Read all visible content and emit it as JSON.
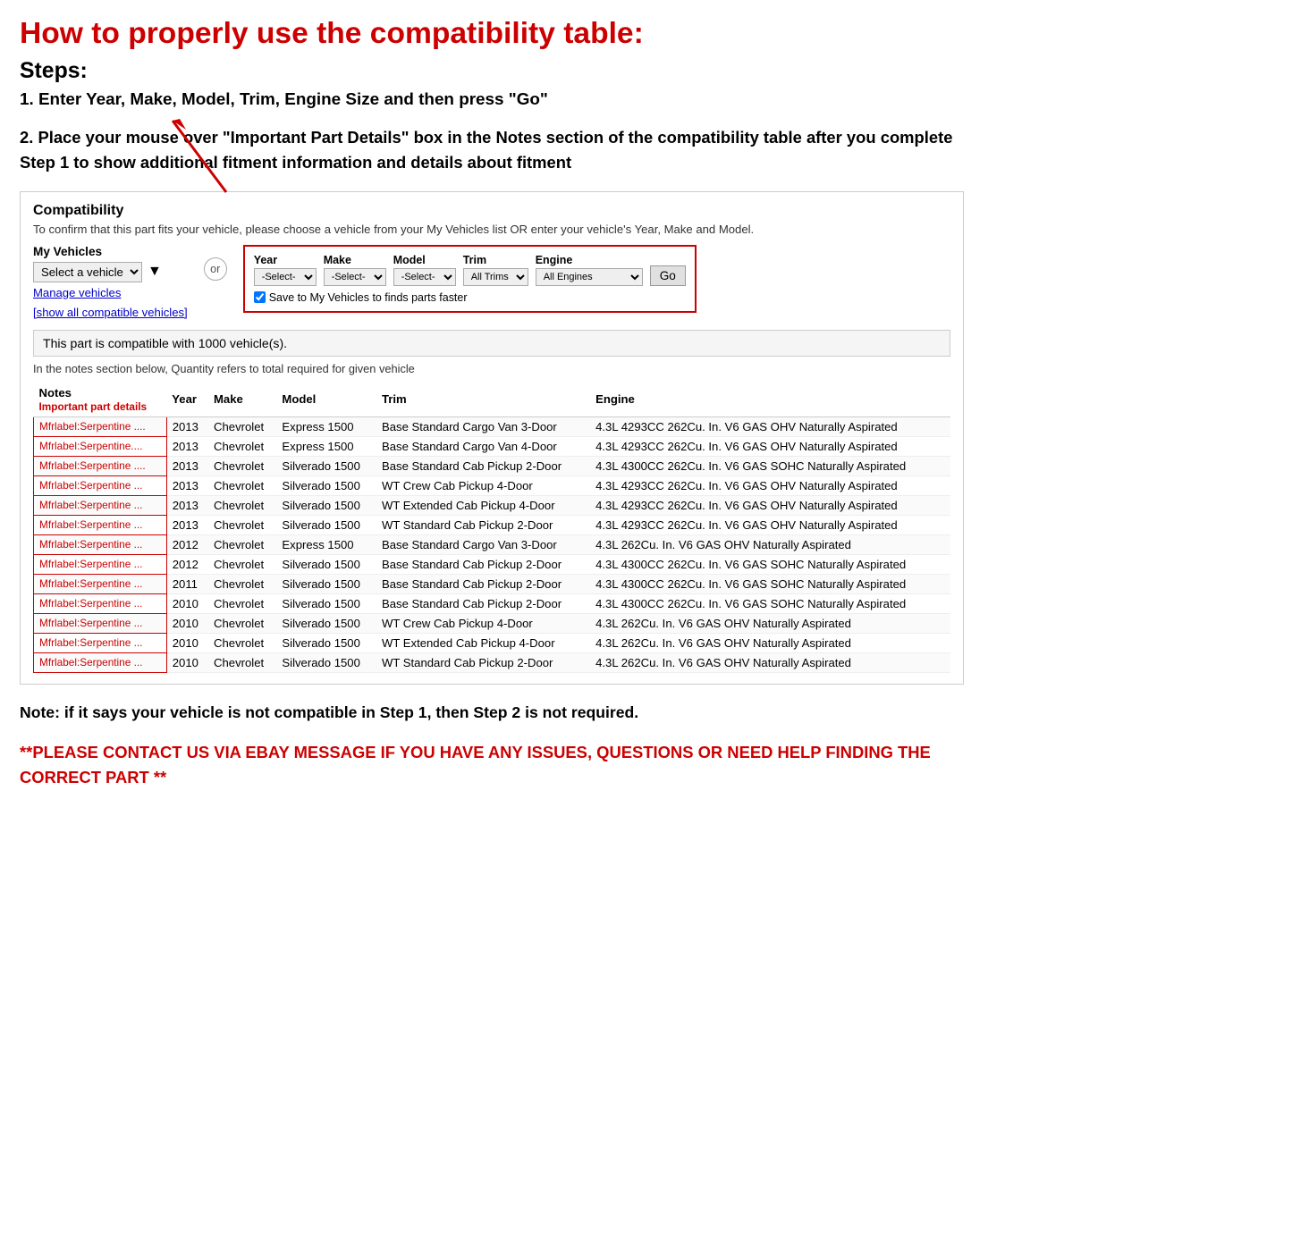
{
  "page": {
    "main_title": "How to properly use the compatibility table:",
    "steps_heading": "Steps:",
    "step1": "1. Enter Year, Make, Model, Trim, Engine Size and then press \"Go\"",
    "step2": "2. Place your mouse over \"Important Part Details\" box in the Notes section of the compatibility table after you complete Step 1 to show additional fitment information and details about fitment",
    "note_body": "Note: if it says your vehicle is not compatible in Step 1, then Step 2 is not required.",
    "contact_note": "**PLEASE CONTACT US VIA EBAY MESSAGE IF YOU HAVE ANY ISSUES, QUESTIONS OR NEED HELP FINDING THE CORRECT PART **"
  },
  "compatibility": {
    "title": "Compatibility",
    "subtitle": "To confirm that this part fits your vehicle, please choose a vehicle from your My Vehicles list OR enter your vehicle's Year, Make and Model.",
    "my_vehicles_label": "My Vehicles",
    "select_vehicle_placeholder": "Select a vehicle",
    "manage_vehicles": "Manage vehicles",
    "show_all": "[show all compatible vehicles]",
    "or_label": "or",
    "year_label": "Year",
    "year_value": "-Select-",
    "make_label": "Make",
    "make_value": "-Select-",
    "model_label": "Model",
    "model_value": "-Select-",
    "trim_label": "Trim",
    "trim_value": "All Trims",
    "engine_label": "Engine",
    "engine_value": "All Engines",
    "go_button": "Go",
    "save_checkbox_label": "Save to My Vehicles to finds parts faster",
    "compat_info": "This part is compatible with 1000 vehicle(s).",
    "compat_note": "In the notes section below, Quantity refers to total required for given vehicle",
    "table_headers": [
      "Notes",
      "Year",
      "Make",
      "Model",
      "Trim",
      "Engine"
    ],
    "notes_sub": "Important part details",
    "table_rows": [
      {
        "notes": "Mfrlabel:Serpentine ....",
        "year": "2013",
        "make": "Chevrolet",
        "model": "Express 1500",
        "trim": "Base Standard Cargo Van 3-Door",
        "engine": "4.3L 4293CC 262Cu. In. V6 GAS OHV Naturally Aspirated"
      },
      {
        "notes": "Mfrlabel:Serpentine....",
        "year": "2013",
        "make": "Chevrolet",
        "model": "Express 1500",
        "trim": "Base Standard Cargo Van 4-Door",
        "engine": "4.3L 4293CC 262Cu. In. V6 GAS OHV Naturally Aspirated"
      },
      {
        "notes": "Mfrlabel:Serpentine ....",
        "year": "2013",
        "make": "Chevrolet",
        "model": "Silverado 1500",
        "trim": "Base Standard Cab Pickup 2-Door",
        "engine": "4.3L 4300CC 262Cu. In. V6 GAS SOHC Naturally Aspirated"
      },
      {
        "notes": "Mfrlabel:Serpentine ...",
        "year": "2013",
        "make": "Chevrolet",
        "model": "Silverado 1500",
        "trim": "WT Crew Cab Pickup 4-Door",
        "engine": "4.3L 4293CC 262Cu. In. V6 GAS OHV Naturally Aspirated"
      },
      {
        "notes": "Mfrlabel:Serpentine ...",
        "year": "2013",
        "make": "Chevrolet",
        "model": "Silverado 1500",
        "trim": "WT Extended Cab Pickup 4-Door",
        "engine": "4.3L 4293CC 262Cu. In. V6 GAS OHV Naturally Aspirated"
      },
      {
        "notes": "Mfrlabel:Serpentine ...",
        "year": "2013",
        "make": "Chevrolet",
        "model": "Silverado 1500",
        "trim": "WT Standard Cab Pickup 2-Door",
        "engine": "4.3L 4293CC 262Cu. In. V6 GAS OHV Naturally Aspirated"
      },
      {
        "notes": "Mfrlabel:Serpentine ...",
        "year": "2012",
        "make": "Chevrolet",
        "model": "Express 1500",
        "trim": "Base Standard Cargo Van 3-Door",
        "engine": "4.3L 262Cu. In. V6 GAS OHV Naturally Aspirated"
      },
      {
        "notes": "Mfrlabel:Serpentine ...",
        "year": "2012",
        "make": "Chevrolet",
        "model": "Silverado 1500",
        "trim": "Base Standard Cab Pickup 2-Door",
        "engine": "4.3L 4300CC 262Cu. In. V6 GAS SOHC Naturally Aspirated"
      },
      {
        "notes": "Mfrlabel:Serpentine ...",
        "year": "2011",
        "make": "Chevrolet",
        "model": "Silverado 1500",
        "trim": "Base Standard Cab Pickup 2-Door",
        "engine": "4.3L 4300CC 262Cu. In. V6 GAS SOHC Naturally Aspirated"
      },
      {
        "notes": "Mfrlabel:Serpentine ...",
        "year": "2010",
        "make": "Chevrolet",
        "model": "Silverado 1500",
        "trim": "Base Standard Cab Pickup 2-Door",
        "engine": "4.3L 4300CC 262Cu. In. V6 GAS SOHC Naturally Aspirated"
      },
      {
        "notes": "Mfrlabel:Serpentine ...",
        "year": "2010",
        "make": "Chevrolet",
        "model": "Silverado 1500",
        "trim": "WT Crew Cab Pickup 4-Door",
        "engine": "4.3L 262Cu. In. V6 GAS OHV Naturally Aspirated"
      },
      {
        "notes": "Mfrlabel:Serpentine ...",
        "year": "2010",
        "make": "Chevrolet",
        "model": "Silverado 1500",
        "trim": "WT Extended Cab Pickup 4-Door",
        "engine": "4.3L 262Cu. In. V6 GAS OHV Naturally Aspirated"
      },
      {
        "notes": "Mfrlabel:Serpentine ...",
        "year": "2010",
        "make": "Chevrolet",
        "model": "Silverado 1500",
        "trim": "WT Standard Cab Pickup 2-Door",
        "engine": "4.3L 262Cu. In. V6 GAS OHV Naturally Aspirated"
      }
    ]
  }
}
